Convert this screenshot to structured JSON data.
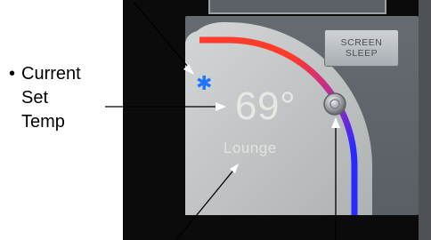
{
  "caption": {
    "bullet": "•",
    "lines": [
      "Current",
      "Set",
      "Temp"
    ]
  },
  "thermostat": {
    "mode_icon": "snowflake-icon",
    "mode_glyph": "✱",
    "set_temperature": "69°",
    "zone_name": "Lounge",
    "dial_knob_icon": "dial-knob-icon",
    "dial_gradient_colors": [
      "#ff3b2b",
      "#b02aa8",
      "#2a2aff"
    ],
    "screen_sleep": {
      "line1": "SCREEN",
      "line2": "SLEEP"
    }
  },
  "colors": {
    "mode_icon": "#1e73ff",
    "dial_face": "#c4c7c8",
    "screen_bg": "#5f646a",
    "device_bezel": "#0b0b0c"
  }
}
